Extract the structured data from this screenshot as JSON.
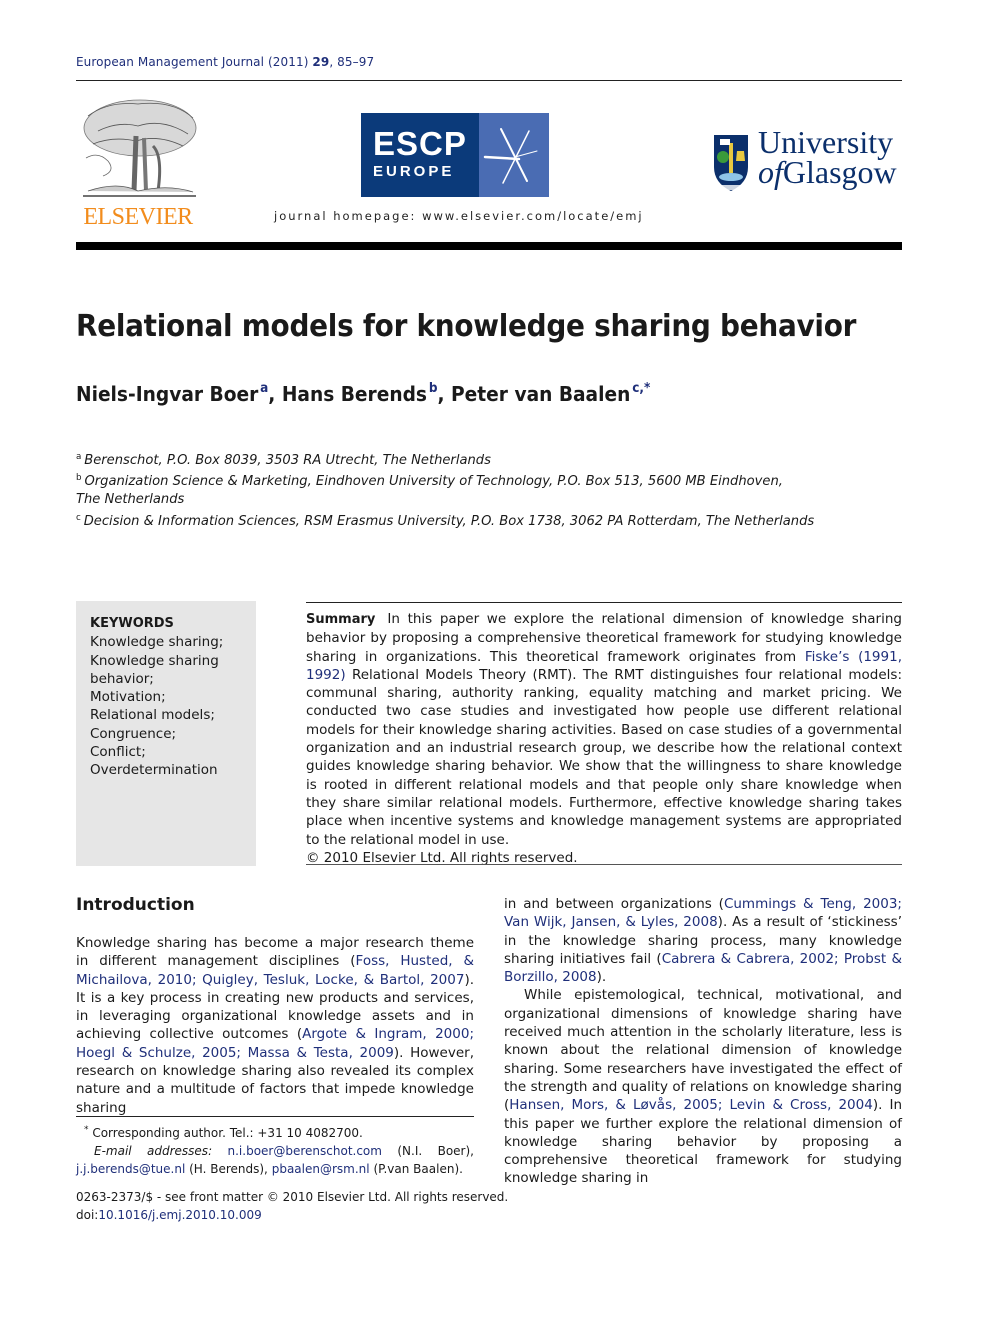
{
  "header": {
    "journal_name": "European Management Journal",
    "year": "(2011)",
    "volume": "29",
    "pages": "85–97",
    "homepage": "journal homepage: www.elsevier.com/locate/emj",
    "publisher_logo": "ELSEVIER",
    "escp_logo": {
      "main": "ESCP",
      "sub": "EUROPE"
    },
    "glasgow_logo": {
      "line1": "University",
      "line2_of": "of",
      "line2": "Glasgow"
    }
  },
  "article": {
    "title": "Relational models for knowledge sharing behavior",
    "authors": [
      {
        "name": "Niels-Ingvar Boer",
        "aff": "a"
      },
      {
        "name": "Hans Berends",
        "aff": "b"
      },
      {
        "name": "Peter van Baalen",
        "aff": "c,*"
      }
    ],
    "affiliations": [
      {
        "mark": "a",
        "text": "Berenschot, P.O. Box 8039, 3503 RA Utrecht, The Netherlands"
      },
      {
        "mark": "b",
        "text": "Organization Science & Marketing, Eindhoven University of Technology, P.O. Box 513, 5600 MB Eindhoven,",
        "cont": "The Netherlands"
      },
      {
        "mark": "c",
        "text": "Decision & Information Sciences, RSM Erasmus University, P.O. Box 1738, 3062 PA Rotterdam, The Netherlands"
      }
    ]
  },
  "keywords": {
    "heading": "KEYWORDS",
    "items": [
      "Knowledge sharing;",
      "Knowledge sharing",
      "behavior;",
      "Motivation;",
      "Relational models;",
      "Congruence;",
      "Conflict;",
      "Overdetermination"
    ]
  },
  "summary": {
    "label": "Summary",
    "text_1": "In this paper we explore the relational dimension of knowledge sharing behavior by proposing a comprehensive theoretical framework for studying knowledge sharing in organizations. This theoretical framework originates from ",
    "link_1": "Fiske’s (1991, 1992)",
    "text_2": " Relational Models Theory (RMT). The RMT distinguishes four relational models: communal sharing, authority ranking, equality matching and market pricing. We conducted two case studies and investigated how people use different relational models for their knowledge sharing activities. Based on case studies of a governmental organization and an industrial research group, we describe how the relational context guides knowledge sharing behavior. We show that the willingness to share knowledge is rooted in different relational models and that people only share knowledge when they share similar relational models. Furthermore, effective knowledge sharing takes place when incentive systems and knowledge management systems are appropriated to the relational model in use.",
    "copyright": "© 2010 Elsevier Ltd. All rights reserved."
  },
  "introduction": {
    "heading": "Introduction",
    "p1_a": "Knowledge sharing has become a major research theme in different management disciplines (",
    "p1_link1": "Foss, Husted, & Michailova, 2010; Quigley, Tesluk, Locke, & Bartol, 2007",
    "p1_b": "). It is a key process in creating new products and services, in leveraging organizational knowledge assets and in achieving collective outcomes (",
    "p1_link2": "Argote & Ingram, 2000; Hoegl & Schulze, 2005; Massa & Testa, 2009",
    "p1_c": "). However, research on knowledge sharing also revealed its complex nature and a multitude of factors that impede knowledge sharing in and between organizations (",
    "p1_link3": "Cummings & Teng, 2003; Van Wijk, Jansen, & Lyles, 2008",
    "p1_d": "). As a result of ‘stickiness’ in the knowledge sharing process, many knowledge sharing initiatives fail (",
    "p1_link4": "Cabrera & Cabrera, 2002; Probst & Borzillo, 2008",
    "p1_e": ").",
    "p2_a": "While epistemological, technical, motivational, and organizational dimensions of knowledge sharing have received much attention in the scholarly literature, less is known about the relational dimension of knowledge sharing. Some researchers have investigated the effect of the strength and quality of relations on knowledge sharing (",
    "p2_link1": "Hansen, Mors, & Løvås, 2005; Levin & Cross, 2004",
    "p2_b": "). In this paper we further explore the relational dimension of knowledge sharing behavior by proposing a comprehensive theoretical framework for studying knowledge sharing in"
  },
  "footnotes": {
    "mark": "*",
    "corresponding": "Corresponding author. Tel.: +31 10 4082700.",
    "email_label": "E-mail addresses:",
    "email1": "n.i.boer@berenschot.com",
    "email1_owner": "(N.I. Boer),",
    "email2": "j.j.berends@tue.nl",
    "email2_owner": "(H. Berends),",
    "email3": "pbaalen@rsm.nl",
    "email3_owner": "(P.van Baalen)."
  },
  "front_matter": {
    "issn_line": "0263-2373/$ - see front matter © 2010 Elsevier Ltd. All rights reserved.",
    "doi_label": "doi:",
    "doi": "10.1016/j.emj.2010.10.009"
  },
  "colors": {
    "link": "#1f2f7a",
    "elsevier_orange": "#f28c1c",
    "escp_dark": "#0b3a7a",
    "escp_light": "#4a6cb3",
    "glasgow_blue": "#0b2f6b",
    "keywords_bg": "#e6e6e6"
  }
}
